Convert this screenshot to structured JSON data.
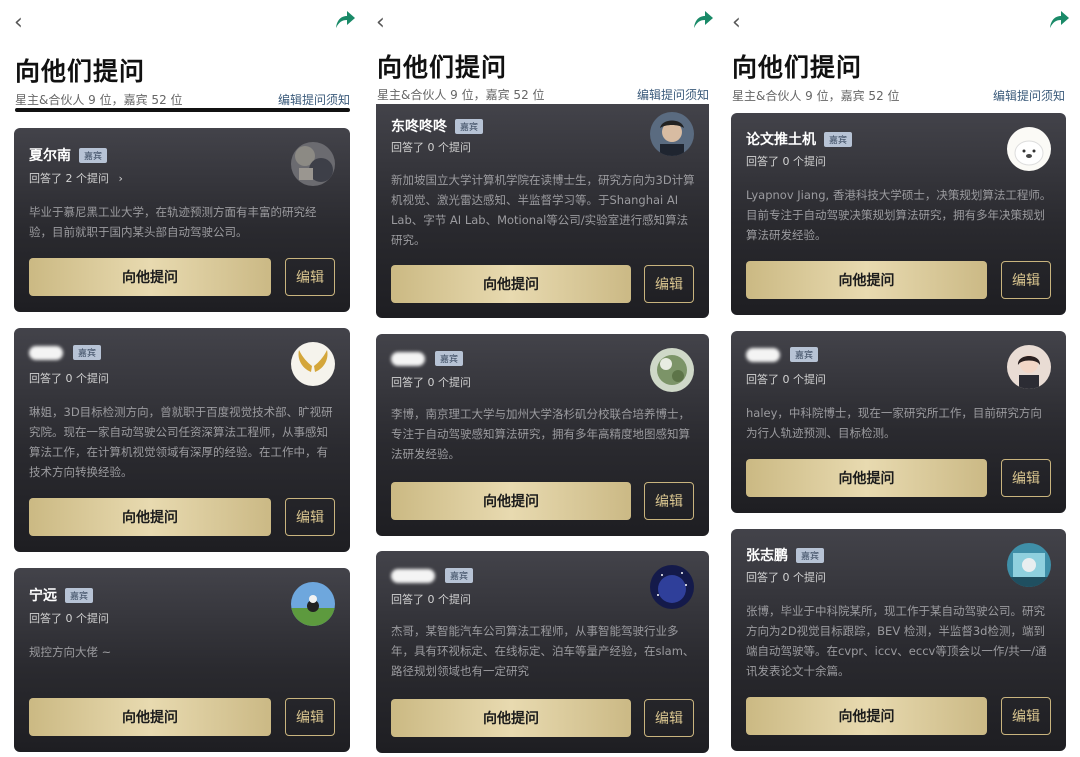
{
  "common": {
    "title": "向他们提问",
    "stats": "星主&合伙人 9 位，嘉宾 52 位",
    "notice": "编辑提问须知",
    "badge": "嘉宾",
    "ask_label": "向他提问",
    "edit_label": "编辑"
  },
  "panels": [
    {
      "cards": [
        {
          "name": "夏尔南",
          "answered": "回答了 2 个提问",
          "bio": "毕业于慕尼黑工业大学，在轨迹预测方面有丰富的研究经验，目前就职于国内某头部自动驾驶公司。"
        },
        {
          "name": "",
          "answered": "回答了 0 个提问",
          "bio": "琳姐，3D目标检测方向，曾就职于百度视觉技术部、旷视研究院。现在一家自动驾驶公司任资深算法工程师，从事感知算法工作，在计算机视觉领域有深厚的经验。在工作中，有技术方向转换经验。"
        },
        {
          "name": "宁远",
          "answered": "回答了 0 个提问",
          "bio": "规控方向大佬 ~"
        }
      ]
    },
    {
      "cards": [
        {
          "name": "东咚咚咚",
          "answered": "回答了 0 个提问",
          "bio": "新加坡国立大学计算机学院在读博士生，研究方向为3D计算机视觉、激光雷达感知、半监督学习等。于Shanghai AI Lab、字节 AI Lab、Motional等公司/实验室进行感知算法研究。"
        },
        {
          "name": "",
          "answered": "回答了 0 个提问",
          "bio": "李博，南京理工大学与加州大学洛杉矶分校联合培养博士，专注于自动驾驶感知算法研究，拥有多年高精度地图感知算法研发经验。"
        },
        {
          "name": "",
          "answered": "回答了 0 个提问",
          "bio": "杰哥，某智能汽车公司算法工程师，从事智能驾驶行业多年，具有环视标定、在线标定、泊车等量产经验，在slam、路径规划领域也有一定研究"
        }
      ]
    },
    {
      "cards": [
        {
          "name": "论文推土机",
          "answered": "回答了 0 个提问",
          "bio": "Lyapnov Jiang, 香港科技大学硕士，决策规划算法工程师。目前专注于自动驾驶决策规划算法研究，拥有多年决策规划算法研发经验。"
        },
        {
          "name": "",
          "answered": "回答了 0 个提问",
          "bio": "haley，中科院博士，现在一家研究所工作，目前研究方向为行人轨迹预测、目标检测。"
        },
        {
          "name": "张志鹏",
          "answered": "回答了 0 个提问",
          "bio": "张博，毕业于中科院某所，现工作于某自动驾驶公司。研究方向为2D视觉目标跟踪，BEV 检测，半监督3d检测，端到端自动驾驶等。在cvpr、iccv、eccv等顶会以一作/共一/通讯发表论文十余篇。"
        }
      ]
    }
  ]
}
